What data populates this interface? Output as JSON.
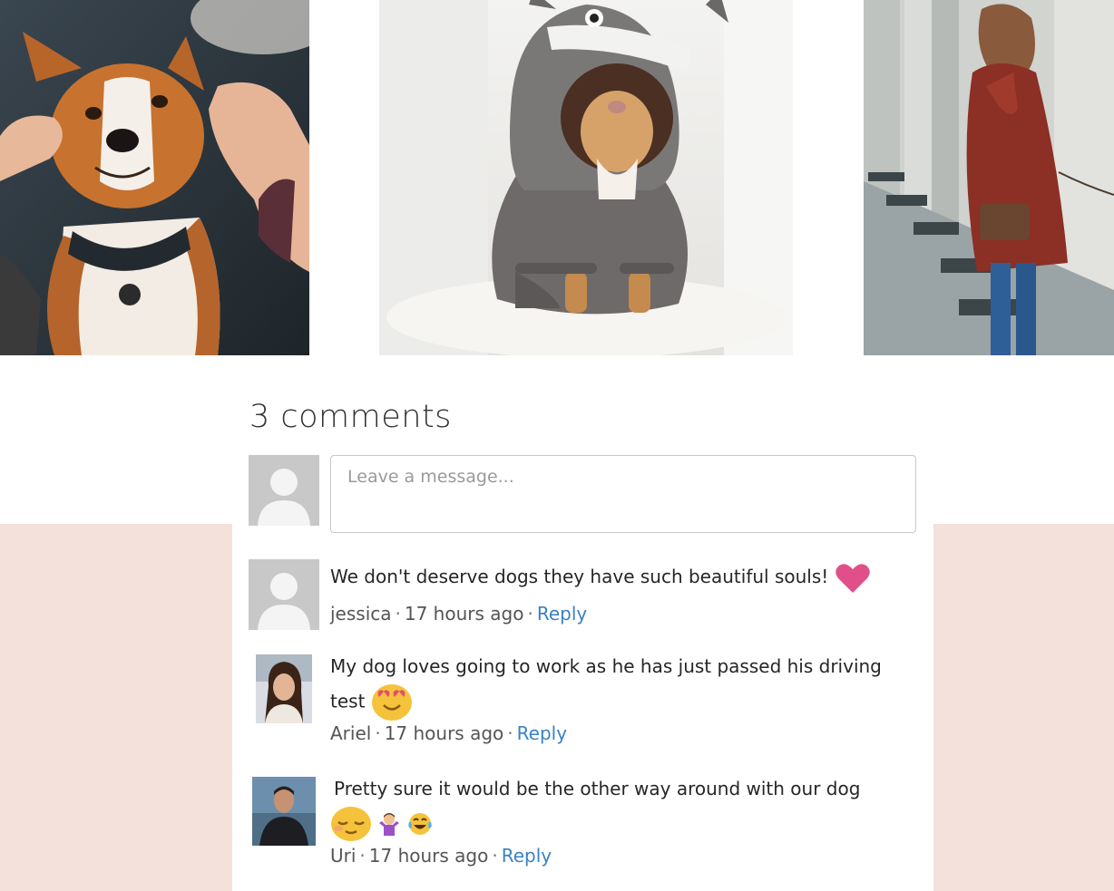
{
  "colors": {
    "band": "#f5e1dc",
    "link": "#3a82c4",
    "heart": "#e04f8a"
  },
  "gallery": {
    "photos": [
      {
        "name": "dog-with-hands-photo"
      },
      {
        "name": "dog-in-totoro-hoodie-photo"
      },
      {
        "name": "woman-walking-dog-photo"
      }
    ]
  },
  "comments": {
    "count_label": "3 comments",
    "composer": {
      "placeholder": "Leave a message..."
    },
    "items": [
      {
        "text": "We don't deserve dogs they have such beautiful souls!",
        "emojis": [
          "heart-icon"
        ],
        "author": "jessica",
        "time": "17 hours ago",
        "reply_label": "Reply"
      },
      {
        "text": "My dog loves going to work as he has just passed his driving test",
        "emojis": [
          "heart-eyes-emoji-icon"
        ],
        "author": "Ariel",
        "time": "17 hours ago",
        "reply_label": "Reply"
      },
      {
        "text": "Pretty sure it would be the other way around with our dog",
        "emojis": [
          "relieved-face-emoji-icon",
          "person-shrugging-emoji-icon",
          "tears-of-joy-emoji-icon"
        ],
        "author": "Uri",
        "time": "17 hours ago",
        "reply_label": "Reply"
      }
    ]
  }
}
